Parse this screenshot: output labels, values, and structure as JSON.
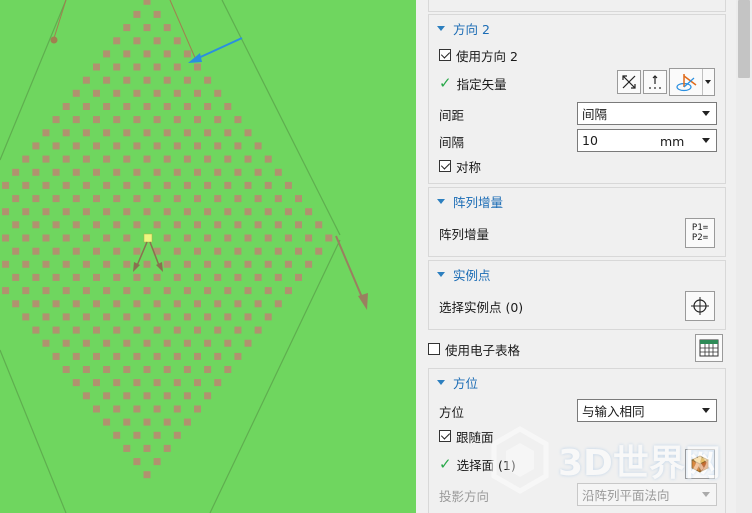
{
  "viewport": {
    "background_color": "#6fd65f",
    "pattern_color": "#b0926f"
  },
  "panel": {
    "direction2": {
      "title": "方向 2",
      "use_direction_label": "使用方向 2",
      "specify_vector_label": "指定矢量",
      "spacing_label": "间距",
      "spacing_value": "间隔",
      "interval_label": "间隔",
      "interval_value": "10",
      "interval_unit": "mm",
      "symmetric_label": "对称"
    },
    "increment": {
      "title": "阵列增量",
      "label": "阵列增量",
      "icon_text_1": "P1=",
      "icon_text_2": "P2="
    },
    "instance": {
      "title": "实例点",
      "select_label": "选择实例点 (0)"
    },
    "spreadsheet": {
      "label": "使用电子表格"
    },
    "orientation": {
      "title": "方位",
      "orientation_label": "方位",
      "orientation_value": "与输入相同",
      "follow_face_label": "跟随面",
      "select_face_label": "选择面 (1)",
      "projection_label": "投影方向",
      "projection_value": "沿阵列平面法向"
    }
  },
  "watermark": {
    "text": "3D世界网"
  }
}
